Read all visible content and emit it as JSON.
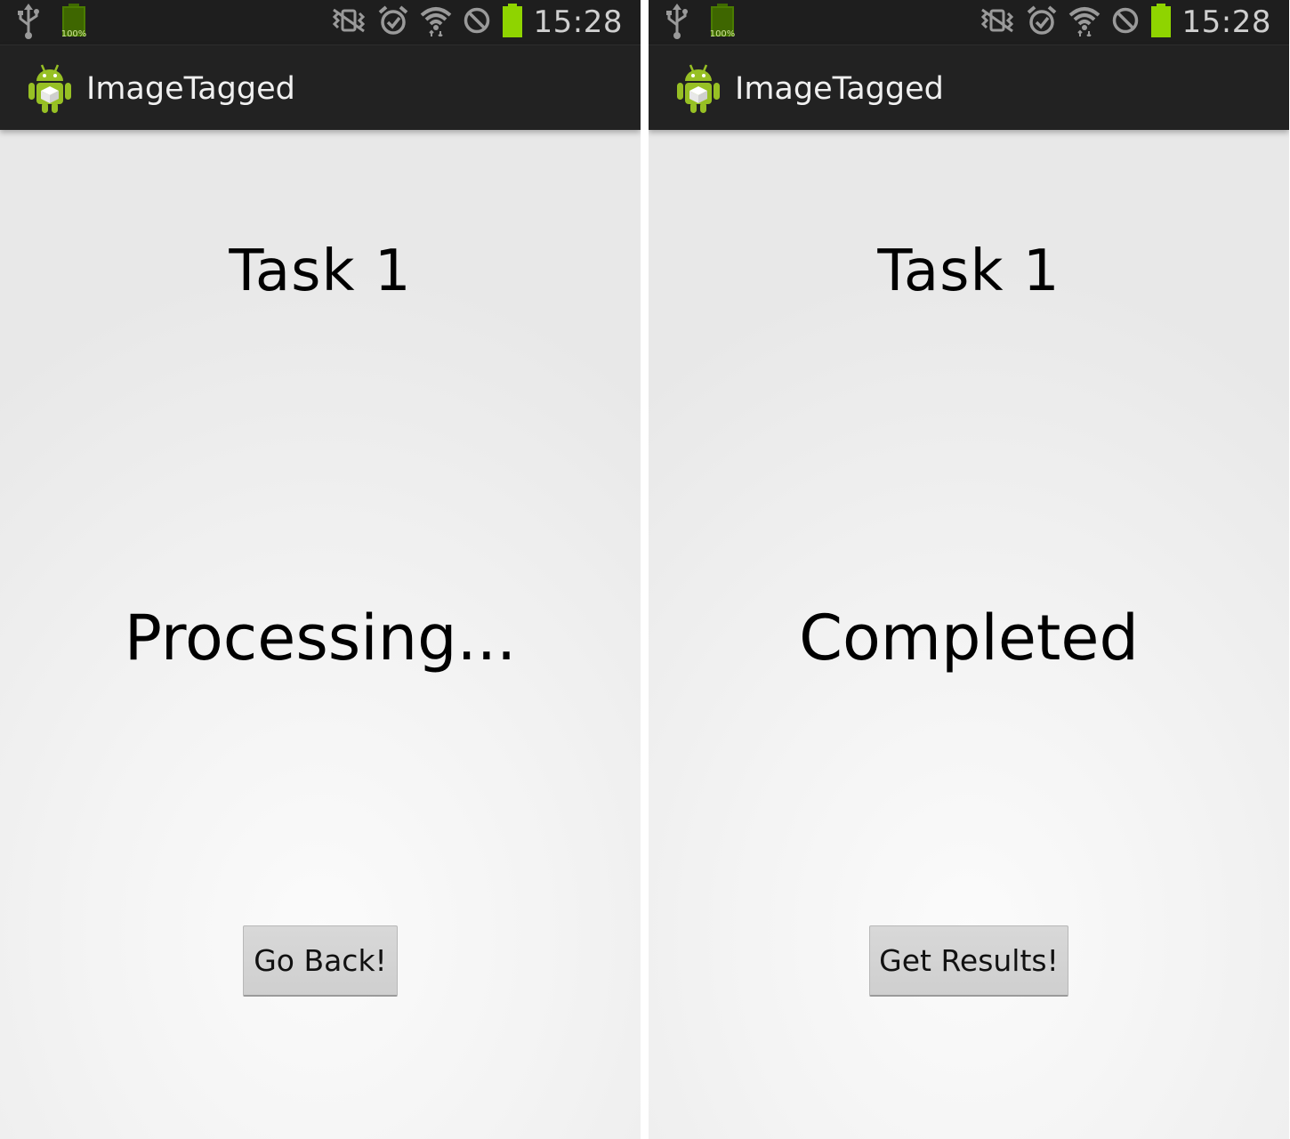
{
  "status_bar": {
    "battery_badge": "100%",
    "time": "15:28",
    "icons": [
      "usb-icon",
      "battery-full-icon",
      "vibrate-icon",
      "alarm-icon",
      "wifi-icon",
      "blocking-icon",
      "battery-icon"
    ],
    "battery_fill_color": "#8fd400"
  },
  "screens": [
    {
      "app_title": "ImageTagged",
      "task_title": "Task 1",
      "status": "Processing...",
      "button_label": "Go Back!"
    },
    {
      "app_title": "ImageTagged",
      "task_title": "Task 1",
      "status": "Completed",
      "button_label": "Get Results!"
    }
  ],
  "colors": {
    "status_bar_bg": "#1e1e1e",
    "action_bar_bg": "#222222",
    "android_green": "#97c024"
  }
}
